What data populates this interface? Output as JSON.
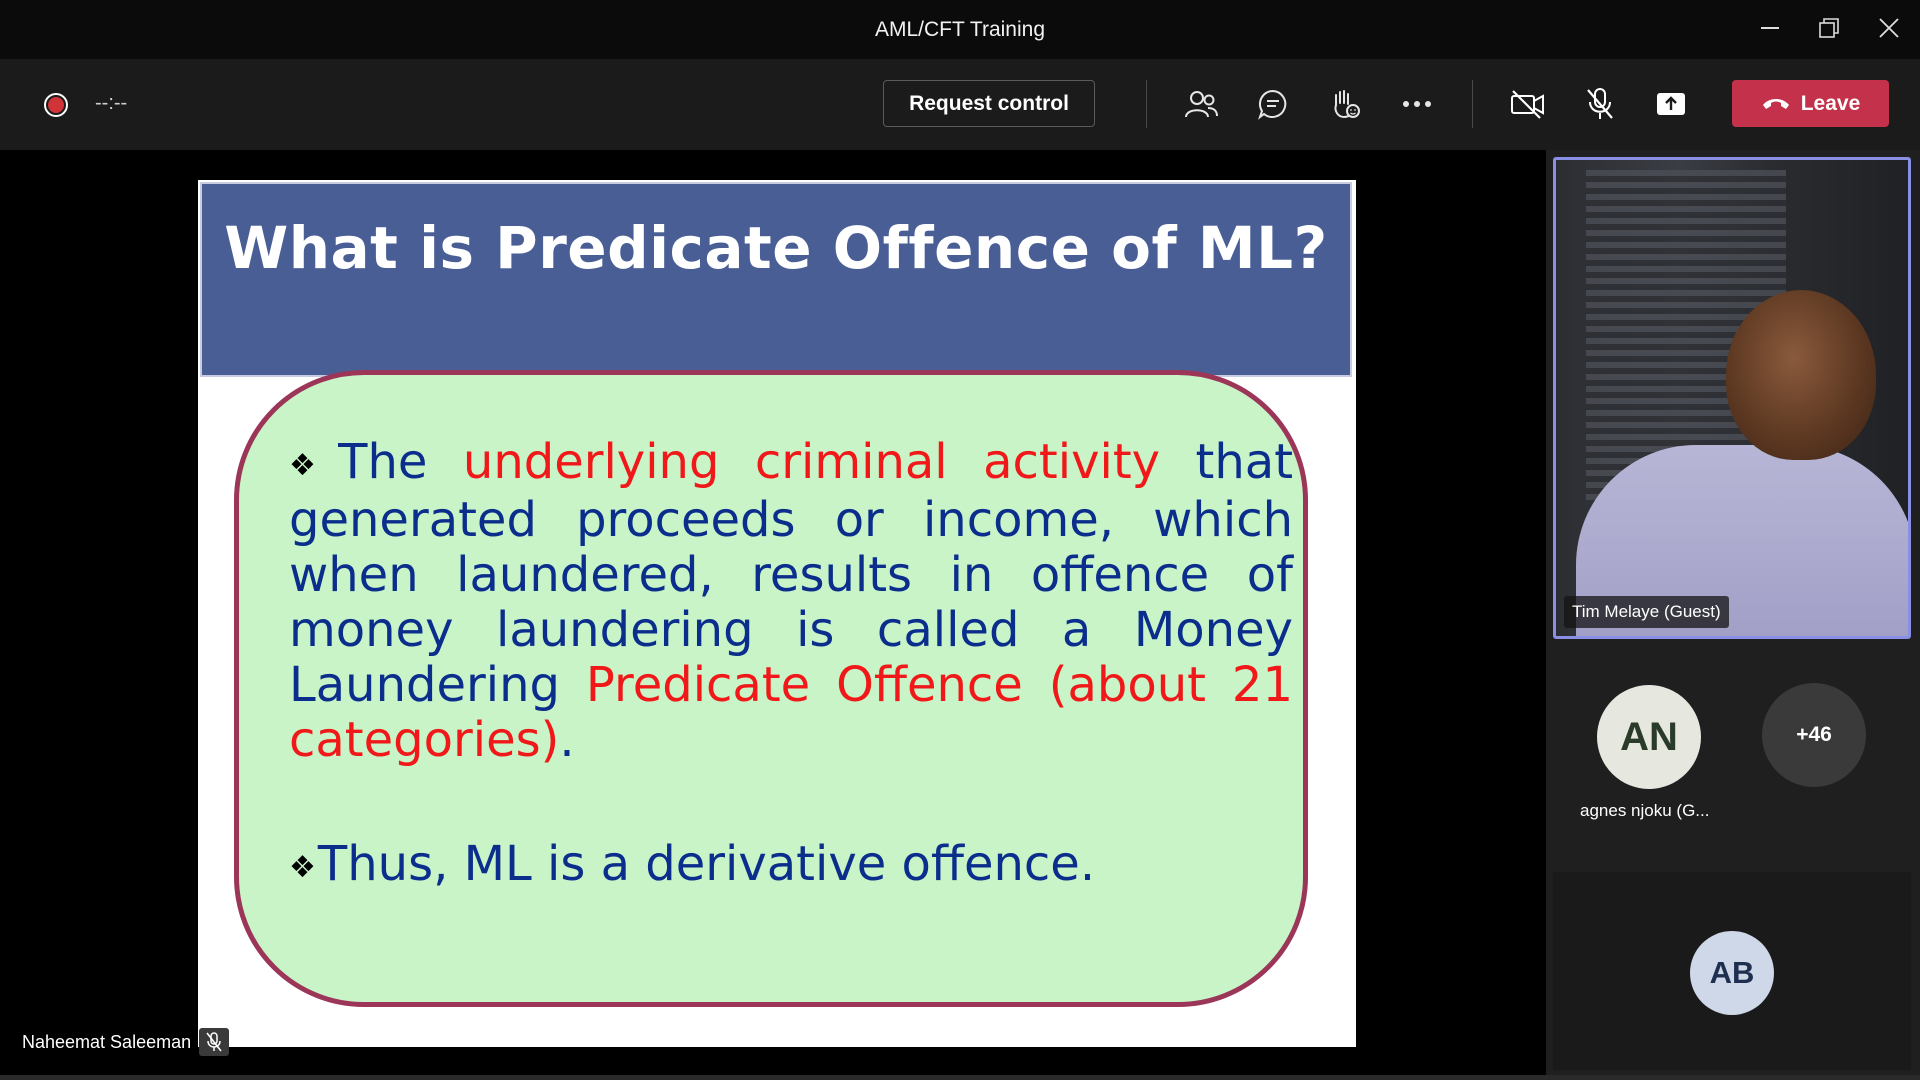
{
  "window": {
    "title": "AML/CFT Training"
  },
  "toolbar": {
    "timer": "--:--",
    "request_control_label": "Request control",
    "leave_label": "Leave",
    "icons": [
      "participants-icon",
      "chat-icon",
      "raise-hand-icon",
      "more-icon",
      "camera-off-icon",
      "mic-off-icon",
      "share-icon"
    ]
  },
  "slide": {
    "title": "What is Predicate Offence of ML?",
    "bullet1": {
      "part1": "The ",
      "part2": "underlying criminal activity",
      "part3": " that generated proceeds or income, which when laundered, results in offence of money laundering is called a Money Laundering ",
      "part4": "Predicate Offence (about 21 categories)",
      "part5": "."
    },
    "bullet2": "Thus, ML is a derivative offence.",
    "bullet_symbol": "❖"
  },
  "participants": {
    "video_name": "Tim Melaye (Guest)",
    "avatar1_initials": "AN",
    "avatar1_label": "agnes njoku (G...",
    "more_count": "+46",
    "avatar2_initials": "AB"
  },
  "presenter": {
    "name": "Naheemat Saleeman"
  },
  "colors": {
    "accent": "#c4314b",
    "slide_header": "#4a5e96",
    "bubble": "#c8f4c8",
    "highlight": "#8a8fe6"
  }
}
